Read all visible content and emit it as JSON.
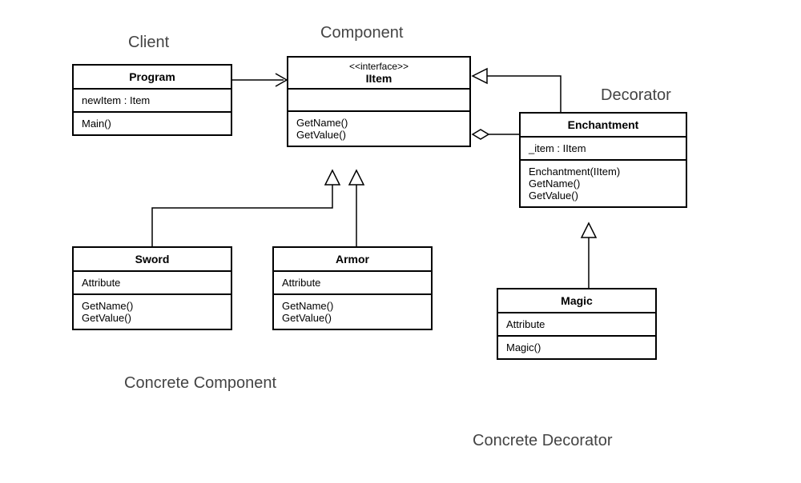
{
  "labels": {
    "client": "Client",
    "component": "Component",
    "decorator": "Decorator",
    "concreteComponent": "Concrete Component",
    "concreteDecorator": "Concrete Decorator"
  },
  "classes": {
    "program": {
      "title": "Program",
      "attr1": "newItem : Item",
      "op1": "Main()"
    },
    "iitem": {
      "stereotype": "<<interface>>",
      "title": "IItem",
      "op1": "GetName()",
      "op2": "GetValue()"
    },
    "enchantment": {
      "title": "Enchantment",
      "attr1": "_item : IItem",
      "op1": "Enchantment(IItem)",
      "op2": "GetName()",
      "op3": "GetValue()"
    },
    "sword": {
      "title": "Sword",
      "attr1": "Attribute",
      "op1": "GetName()",
      "op2": "GetValue()"
    },
    "armor": {
      "title": "Armor",
      "attr1": "Attribute",
      "op1": "GetName()",
      "op2": "GetValue()"
    },
    "magic": {
      "title": "Magic",
      "attr1": "Attribute",
      "op1": "Magic()"
    }
  }
}
